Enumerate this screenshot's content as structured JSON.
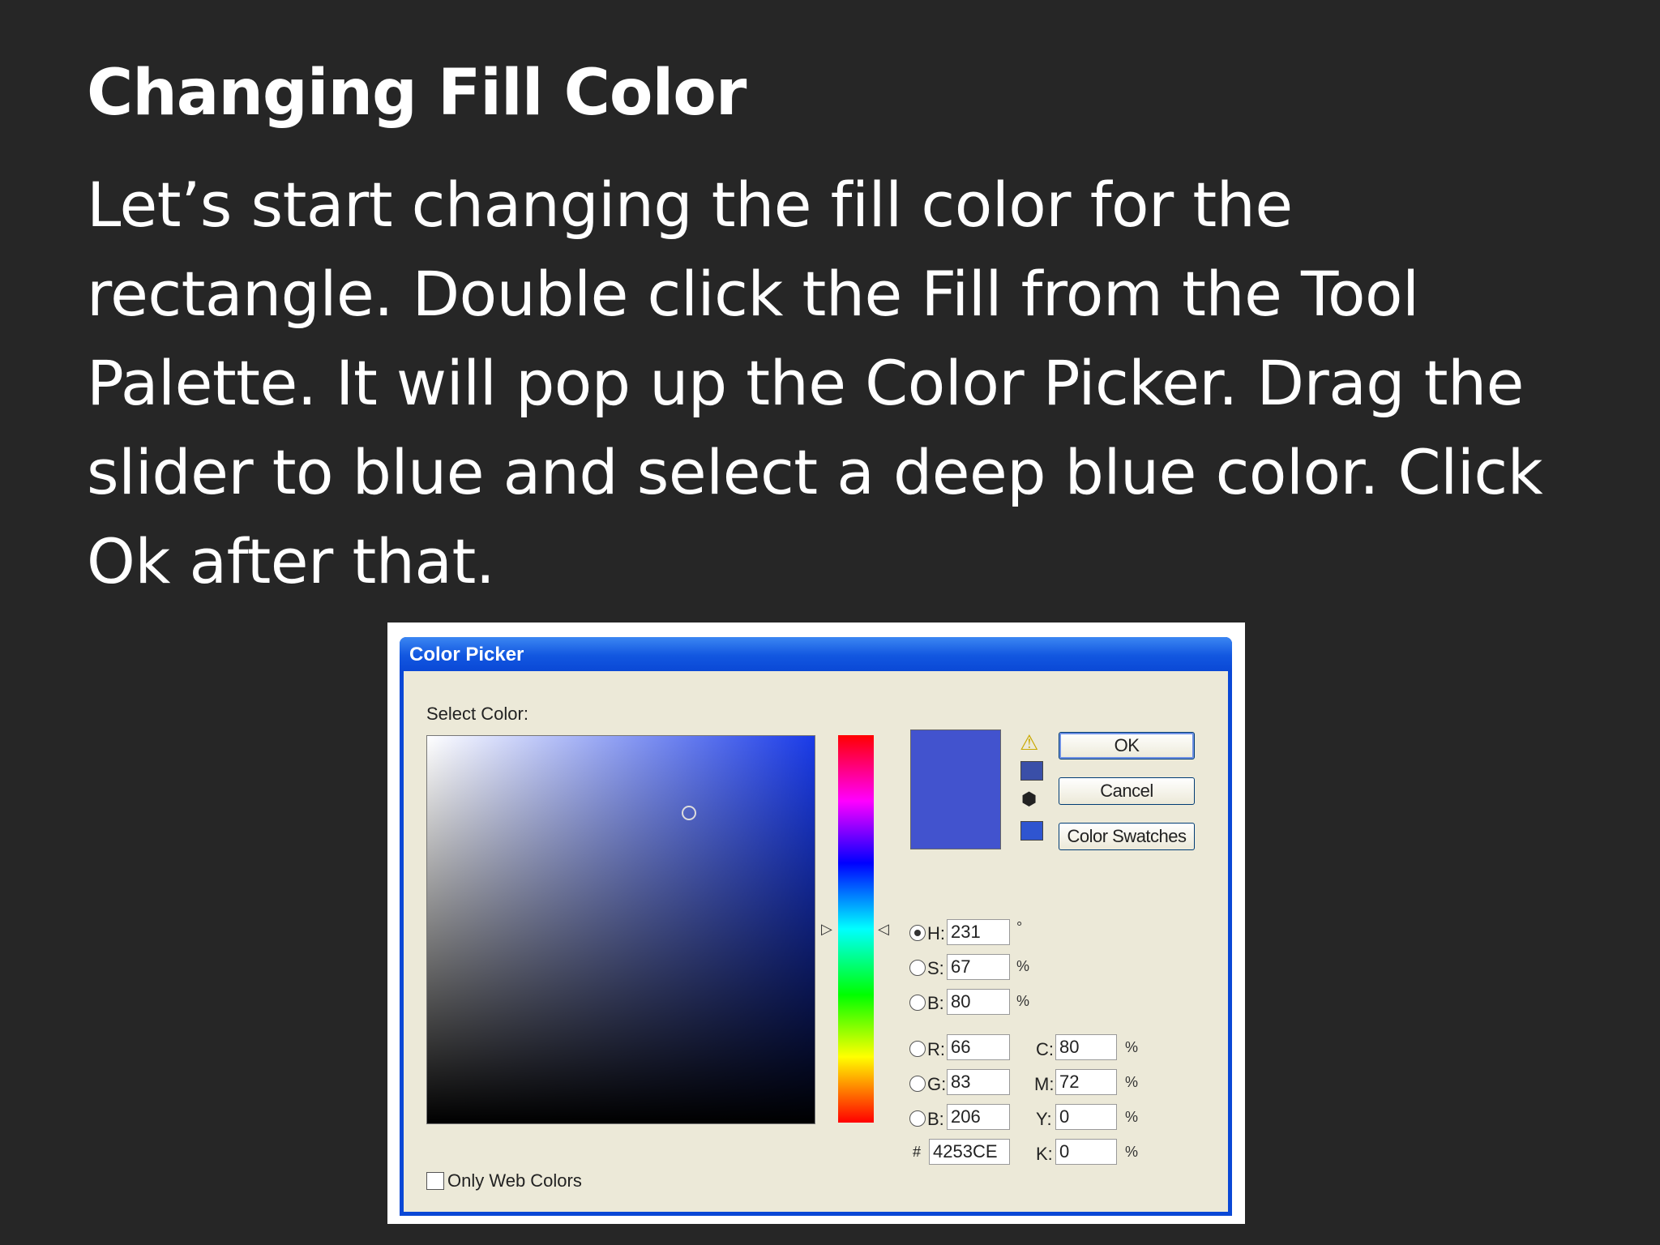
{
  "slide": {
    "title": "Changing Fill Color",
    "body": "Let’s start changing the fill color for the rectangle. Double click the Fill from the Tool Palette. It will pop up the Color Picker. Drag the slider to blue and select a deep blue color. Click Ok after that."
  },
  "dialog": {
    "title": "Color Picker",
    "select_label": "Select Color:",
    "ok_label": "OK",
    "cancel_label": "Cancel",
    "swatches_label": "Color Swatches",
    "only_web_label": "Only Web Colors",
    "current_color": "#4253CE",
    "fields": {
      "h_label": "H:",
      "h_value": "231",
      "h_unit": "°",
      "s_label": "S:",
      "s_value": "67",
      "s_unit": "%",
      "b_label": "B:",
      "b_value": "80",
      "b_unit": "%",
      "r_label": "R:",
      "r_value": "66",
      "g_label": "G:",
      "g_value": "83",
      "b2_label": "B:",
      "b2_value": "206",
      "hex_label": "#",
      "hex_value": "4253CE",
      "c_label": "C:",
      "c_value": "80",
      "c_unit": "%",
      "m_label": "M:",
      "m_value": "72",
      "m_unit": "%",
      "y_label": "Y:",
      "y_value": "0",
      "y_unit": "%",
      "k_label": "K:",
      "k_value": "0",
      "k_unit": "%"
    },
    "icons": {
      "warning": "warning-triangle",
      "cube": "cube",
      "gamut_swatch_color": "#3a4fa8",
      "web_swatch_color": "#2f55d0"
    }
  }
}
